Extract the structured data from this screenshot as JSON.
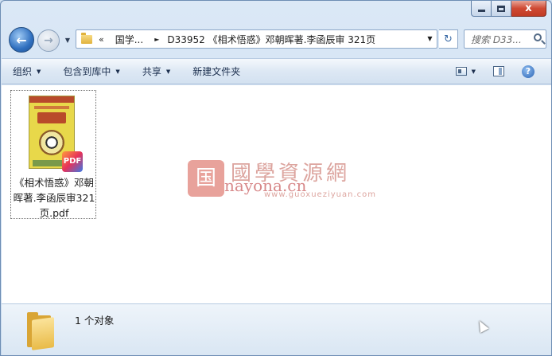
{
  "window": {
    "caption": {
      "close_glyph": "x"
    }
  },
  "nav": {
    "back_glyph": "←",
    "forward_glyph": "→",
    "history_glyph": "▼",
    "address": {
      "overflow_chevron": "«",
      "segments": [
        "国学...",
        "D33952 《相术悟惑》邓朝晖著.李函辰审 321页"
      ],
      "separator": "►",
      "dropdown_glyph": "▼"
    },
    "refresh_glyph": "↻",
    "search": {
      "placeholder": "搜索 D33..."
    }
  },
  "command_bar": {
    "items": [
      {
        "label": "组织",
        "has_caret": true
      },
      {
        "label": "包含到库中",
        "has_caret": true
      },
      {
        "label": "共享",
        "has_caret": true
      },
      {
        "label": "新建文件夹",
        "has_caret": false
      }
    ],
    "caret_glyph": "▼",
    "help_glyph": "?"
  },
  "files": [
    {
      "name": "《相术悟惑》邓朝晖著.李函辰审321页.pdf",
      "badge": "PDF"
    }
  ],
  "watermark": {
    "seal": "国",
    "title": "國學資源網",
    "domain": "nayona.cn",
    "url": "www.guoxueziyuan.com"
  },
  "details": {
    "count_text": "1 个对象"
  },
  "colors": {
    "accent": "#2f6fbf",
    "close_button": "#cf4a34",
    "folder": "#e9bb48"
  }
}
